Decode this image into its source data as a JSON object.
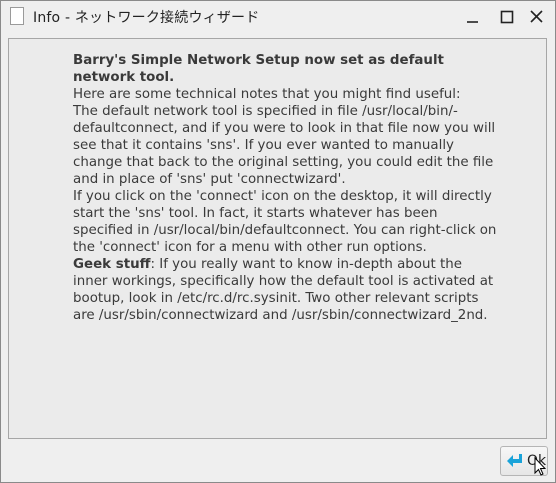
{
  "window": {
    "title": "Info - ネットワーク接続ウィザード",
    "controls": [
      "minimize-icon",
      "maximize-icon",
      "close-icon"
    ]
  },
  "message": {
    "heading_line1": "Barry's Simple Network Setup now set as default",
    "heading_line2": "network tool.",
    "lines": [
      "Here are some technical notes that you might find useful:",
      "The default network tool is specified in file /usr/local/bin/-",
      "defaultconnect, and if you were to look in that file now you will",
      "see that it contains 'sns'. If you ever wanted to manually",
      "change that back to the original setting, you could edit the file",
      "and in place of 'sns' put 'connectwizard'.",
      "If you click on the 'connect' icon on the desktop, it will directly",
      "start the 'sns' tool. In fact, it starts whatever has been",
      "specified in /usr/local/bin/defaultconnect. You can right-click on",
      "the 'connect' icon for a menu with other run options."
    ],
    "geek_label": "Geek stuff",
    "geek_first": ": If you really want to know in-depth about the",
    "geek_lines": [
      "inner workings, specifically how the default tool is activated at",
      "bootup, look in /etc/rc.d/rc.sysinit. Two other relevant scripts",
      "are /usr/sbin/connectwizard and /usr/sbin/connectwizard_2nd."
    ]
  },
  "buttons": {
    "ok_label": "Ok",
    "ok_icon": "return-arrow-icon"
  },
  "colors": {
    "ok_icon_color": "#1aa3d9"
  }
}
